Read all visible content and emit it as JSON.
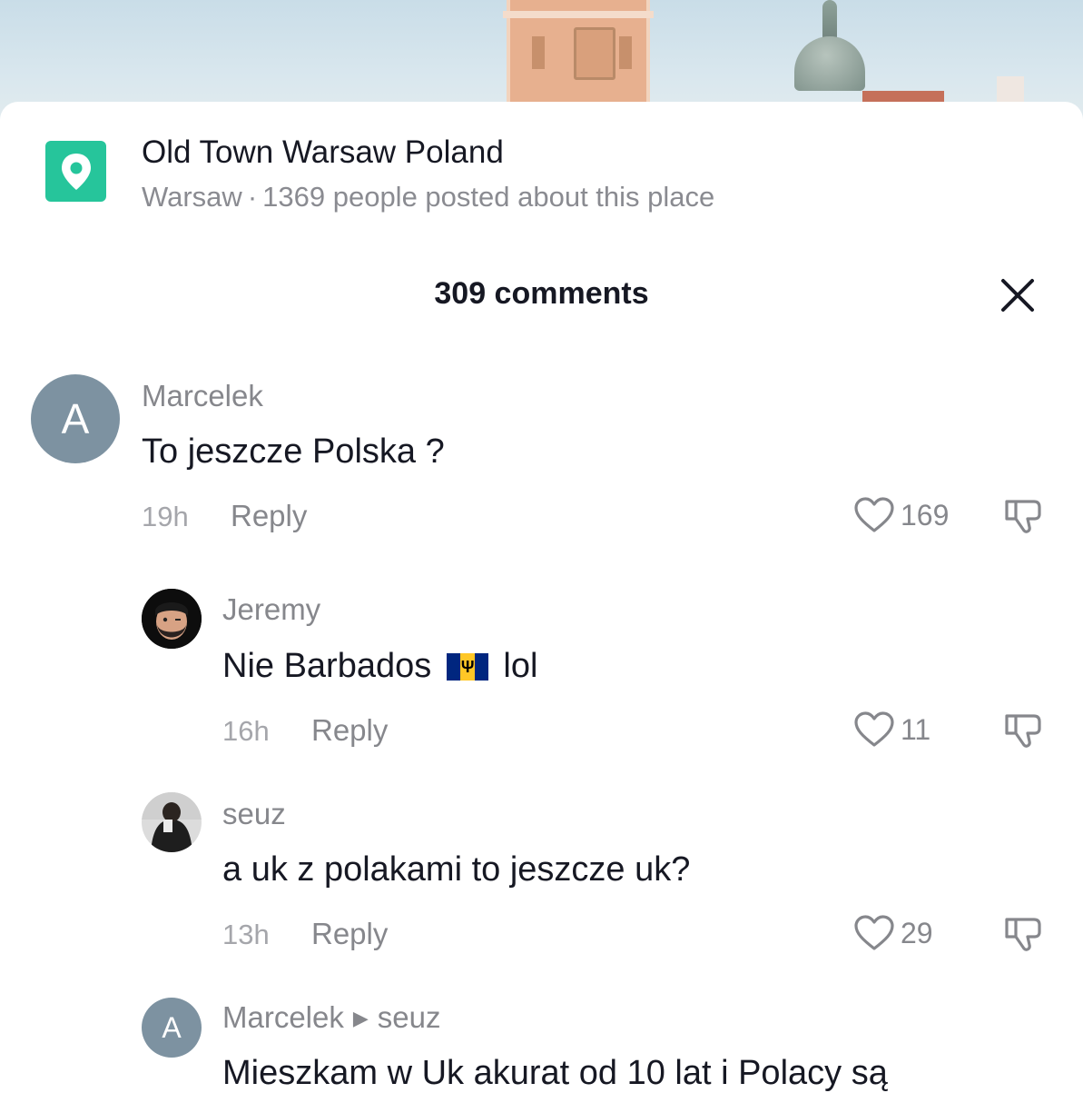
{
  "location": {
    "name": "Old Town Warsaw Poland",
    "city": "Warsaw",
    "separator": "·",
    "posted": "1369 people posted about this place",
    "icon": "map-pin-icon",
    "accent": "#26c59b"
  },
  "header": {
    "count_label": "309 comments",
    "close_icon": "close-icon"
  },
  "comments": [
    {
      "avatar_letter": "A",
      "username": "Marcelek",
      "text": "To jeszcze Polska ?",
      "time": "19h",
      "reply": "Reply",
      "likes": "169"
    },
    {
      "avatar": "memoji-avatar",
      "username": "Jeremy",
      "text_before": "Nie Barbados",
      "flag": "barbados-flag",
      "text_after": "lol",
      "time": "16h",
      "reply": "Reply",
      "likes": "11"
    },
    {
      "avatar": "photo-avatar",
      "username": "seuz",
      "text": "a uk z polakami to jeszcze uk?",
      "time": "13h",
      "reply": "Reply",
      "likes": "29"
    },
    {
      "avatar_letter": "A",
      "username": "Marcelek",
      "reply_to": "seuz",
      "text": "Mieszkam w Uk akurat od 10 lat i Polacy są"
    }
  ],
  "colors": {
    "text_primary": "#161823",
    "text_secondary": "#86878c",
    "avatar_bg": "#7d92a1"
  }
}
